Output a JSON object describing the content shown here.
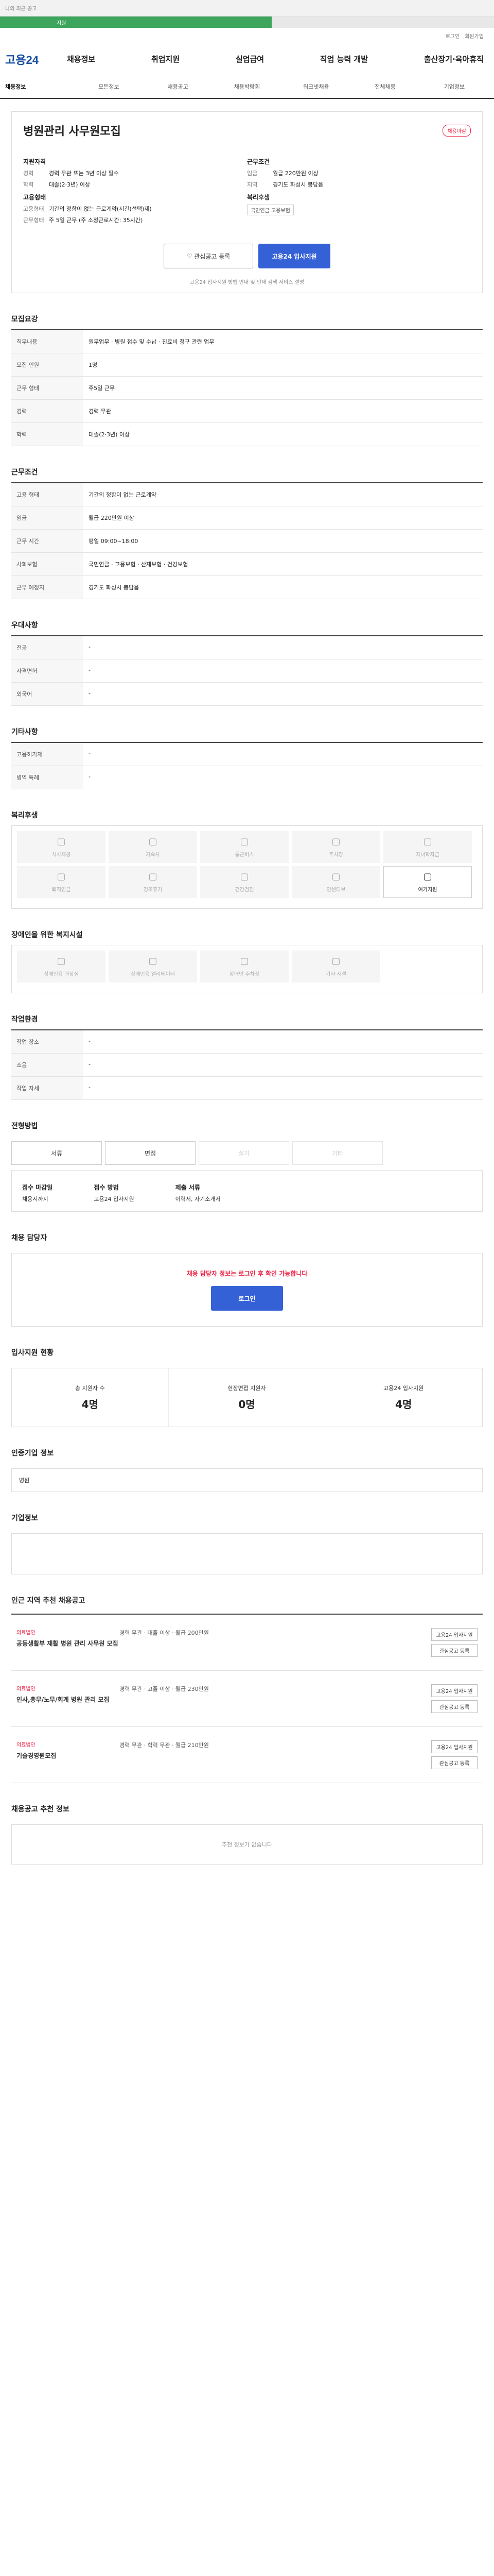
{
  "topbar": {
    "left": "나의 최근 공고"
  },
  "progress": {
    "label": "지원",
    "pct": 0.55
  },
  "util": [
    "로그인",
    "회원가입"
  ],
  "gnb": {
    "logo": "고용24",
    "menu": [
      "채용정보",
      "취업지원",
      "실업급여",
      "직업 능력 개발",
      "출산장기·육아휴직"
    ]
  },
  "sub": [
    "채용정보",
    "모든정보",
    "채용공고",
    "채용박람회",
    "워크넷채용",
    "전체채용",
    "기업정보"
  ],
  "job": {
    "title": "병원관리 사무원모집",
    "badge": "채용마감",
    "left": {
      "head": "지원자격",
      "career_l": "경력",
      "career_v": "경력 무관 또는 3년 이상 필수",
      "edu_l": "학력",
      "edu_v": "대졸(2·3년) 이상",
      "emp_h": "고용형태",
      "emp_l": "고용형태",
      "emp_v": "기간의 정함이 없는 근로계약(시간(선택)제)",
      "place_l": "근무형태",
      "place_v": "주 5일 근무 (주 소정근로시간: 35시간)"
    },
    "right": {
      "head": "근무조건",
      "pay_l": "임금",
      "pay_v": "월급 220만원 이상",
      "region_l": "지역",
      "region_v": "경기도 화성시 봉담읍",
      "acc_h": "복리후생",
      "acc_v": "국민연금 고용보험"
    }
  },
  "buttons": {
    "fav": "관심공고 등록",
    "apply": "고용24 입사지원"
  },
  "note": "고용24 입사지원 방법 안내 및 인재 검색 서비스 설명",
  "s1": {
    "title": "모집요강",
    "rows": [
      [
        "직무내용",
        "원무업무 · 병원 접수 및 수납 · 진료비 청구 관련 업무"
      ],
      [
        "모집 인원",
        "1명"
      ],
      [
        "근무 형태",
        "주5일 근무"
      ],
      [
        "경력",
        "경력 무관"
      ],
      [
        "학력",
        "대졸(2·3년) 이상"
      ]
    ]
  },
  "s2": {
    "title": "근무조건",
    "rows": [
      [
        "고용 형태",
        "기간의 정함이 없는 근로계약"
      ],
      [
        "임금",
        "월급 220만원 이상"
      ],
      [
        "근무 시간",
        "평일 09:00~18:00"
      ],
      [
        "사회보험",
        "국민연금 · 고용보험 · 산재보험 · 건강보험"
      ],
      [
        "근무 예정지",
        "경기도 화성시 봉담읍"
      ]
    ]
  },
  "s3": {
    "title": "우대사항",
    "rows": [
      [
        "전공",
        "-"
      ],
      [
        "자격면허",
        "-"
      ],
      [
        "외국어",
        "-"
      ]
    ]
  },
  "s4": {
    "title": "기타사항",
    "rows": [
      [
        "고용허가제",
        "-"
      ],
      [
        "병역 특례",
        "-"
      ]
    ]
  },
  "s5": {
    "title": "복리후생",
    "items": [
      "식사제공",
      "기숙사",
      "통근버스",
      "주차장",
      "자녀학자금",
      "퇴직연금",
      "경조휴가",
      "건강검진",
      "인센티브",
      "여가지원"
    ]
  },
  "s6": {
    "title": "장애인을 위한 복지시설",
    "items": [
      "장애인용 화장실",
      "장애인용 엘리베이터",
      "장애인 주차장",
      "기타 시설"
    ]
  },
  "s7": {
    "title": "작업환경",
    "rows": [
      [
        "작업 장소",
        "-"
      ],
      [
        "소음",
        "-"
      ],
      [
        "작업 자세",
        "-"
      ]
    ]
  },
  "s8": {
    "title": "전형방법",
    "tabs": [
      "서류",
      "면접",
      "실기",
      "기타"
    ],
    "l1": "접수 마감일",
    "v1": "채용시까지",
    "l2": "접수 방법",
    "v2": "고용24 입사지원",
    "l3": "제출 서류",
    "v3": "이력서, 자기소개서"
  },
  "s9": {
    "title": "채용 담당자",
    "msg": "채용 담당자 정보는 로그인 후 확인 가능합니다",
    "btn": "로그인"
  },
  "s10": {
    "title": "입사지원 현황",
    "stats": [
      [
        "총 지원자 수",
        "4명"
      ],
      [
        "현장면접 지원자",
        "0명"
      ],
      [
        "고용24 입사지원",
        "4명"
      ]
    ]
  },
  "s11": {
    "title": "인증기업 정보",
    "company": "병원"
  },
  "s12": {
    "title": "기업정보"
  },
  "s13": {
    "title": "인근 지역 추천 채용공고",
    "rows": [
      {
        "co": "의료법인",
        "title": "공동생활부 재활 병원 관리 사무원 모집",
        "meta": "경력 무관 · 대졸 이상 · 월급 200만원"
      },
      {
        "co": "의료법인",
        "title": "인사,총무/노무/회계 병원 관리 모집",
        "meta": "경력 무관 · 고졸 이상 · 월급 230만원"
      },
      {
        "co": "의료법인",
        "title": "기술경영원모집",
        "meta": "경력 무관 · 학력 무관 · 월급 210만원"
      }
    ]
  },
  "s14": {
    "title": "채용공고 추천 정보",
    "empty": "추천 정보가 없습니다"
  }
}
